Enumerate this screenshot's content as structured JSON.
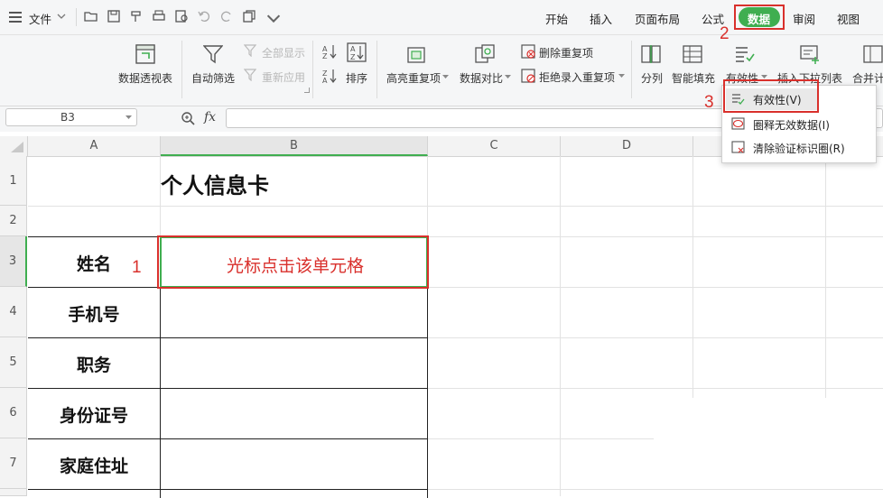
{
  "menubar": {
    "file_label": "文件",
    "tabs": [
      "开始",
      "插入",
      "页面布局",
      "公式",
      "数据",
      "审阅",
      "视图"
    ],
    "active_tab": "数据",
    "active_color": "#3fae50"
  },
  "ribbon": {
    "pivot": "数据透视表",
    "autofilter": "自动筛选",
    "show_all": "全部显示",
    "reapply": "重新应用",
    "sort": "排序",
    "highlight_dup": "高亮重复项",
    "data_compare": "数据对比",
    "delete_dup": "删除重复项",
    "reject_dup": "拒绝录入重复项",
    "split_col": "分列",
    "smart_fill": "智能填充",
    "validity": "有效性",
    "insert_dropdown": "插入下拉列表",
    "consolidate": "合并计"
  },
  "formula_bar": {
    "cell_ref": "B3",
    "fx": "fx",
    "value": ""
  },
  "grid": {
    "columns": [
      "A",
      "B",
      "C",
      "D"
    ],
    "rows": [
      "1",
      "2",
      "3",
      "4",
      "5",
      "6",
      "7"
    ],
    "title": "个人信息卡",
    "labels": [
      "姓名",
      "手机号",
      "职务",
      "身份证号",
      "家庭住址"
    ],
    "b3_hint": "光标点击该单元格"
  },
  "dropdown": {
    "items": [
      "有效性(V)",
      "圈释无效数据(I)",
      "清除验证标识圈(R)"
    ]
  },
  "annotations": {
    "step1": "1",
    "step2": "2",
    "step3": "3",
    "color": "#d9302c"
  }
}
